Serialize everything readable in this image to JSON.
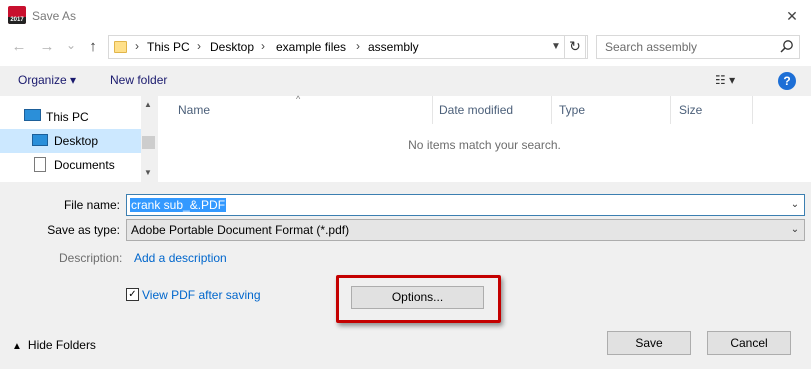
{
  "window": {
    "title": "Save As",
    "close_glyph": "✕",
    "logo_text": "2017"
  },
  "nav": {
    "back_glyph": "←",
    "forward_glyph": "→",
    "recent_glyph": "⌄",
    "up_glyph": "↑",
    "breadcrumbs": [
      "This PC",
      "Desktop",
      "example files",
      "assembly"
    ],
    "separator": "›",
    "refresh_glyph": "↻",
    "search_placeholder": "Search assembly"
  },
  "toolbar": {
    "organize_label": "Organize ▾",
    "new_folder_label": "New folder",
    "view_glyph": "☷ ▾",
    "help_glyph": "?"
  },
  "sidebar": {
    "items": [
      {
        "label": "This PC"
      },
      {
        "label": "Desktop"
      },
      {
        "label": "Documents"
      }
    ]
  },
  "file_list": {
    "columns": [
      "Name",
      "Date modified",
      "Type",
      "Size"
    ],
    "empty_message": "No items match your search."
  },
  "form": {
    "filename_label": "File name:",
    "filename_value": "crank sub_&.PDF",
    "savetype_label": "Save as type:",
    "savetype_value": "Adobe Portable Document Format (*.pdf)",
    "description_label": "Description:",
    "add_description_link": "Add a description",
    "view_pdf_label": "View PDF after saving",
    "view_pdf_checked": true,
    "options_label": "Options..."
  },
  "footer": {
    "hide_folders_label": "Hide Folders",
    "save_label": "Save",
    "cancel_label": "Cancel"
  },
  "colors": {
    "accent": "#0066cc",
    "highlight_box": "#c40000",
    "selection": "#3399ff",
    "nav_selected": "#cce8ff"
  }
}
